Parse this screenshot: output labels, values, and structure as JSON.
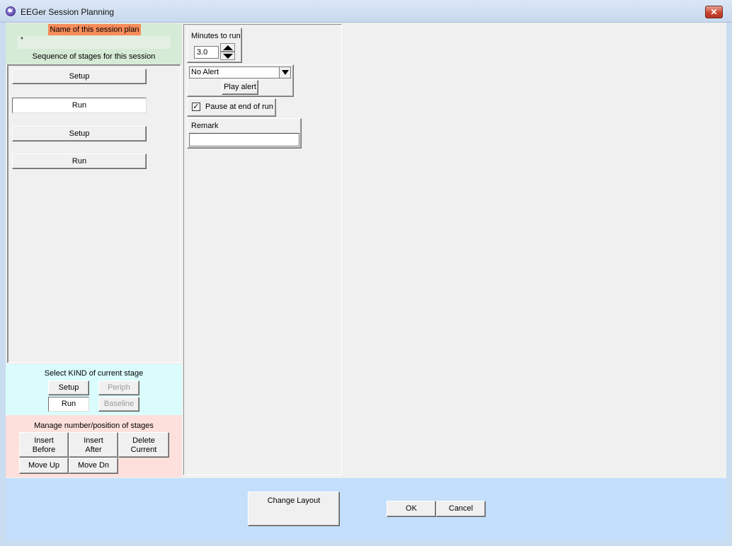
{
  "window": {
    "title": "EEGer Session Planning",
    "close_symbol": "✕",
    "icon_text": "W"
  },
  "name_panel": {
    "label": "Name of this session plan",
    "name_value": "*",
    "sequence_label": "Sequence of stages for this session"
  },
  "stages": [
    "Setup",
    "Run",
    "Setup",
    "Run"
  ],
  "selected_stage_index": 1,
  "kind_panel": {
    "title": "Select KIND of current stage",
    "setup": "Setup",
    "periph": "Periph",
    "run": "Run",
    "baseline": "Baseline"
  },
  "manage_panel": {
    "title": "Manage number/position of stages",
    "insert_before_1": "Insert",
    "insert_before_2": "Before",
    "insert_after_1": "Insert",
    "insert_after_2": "After",
    "delete_current_1": "Delete",
    "delete_current_2": "Current",
    "move_up": "Move Up",
    "move_dn": "Move Dn"
  },
  "run_settings": {
    "minutes_label": "Minutes to run",
    "minutes_value": "3.0",
    "alert_selected": "No Alert",
    "play_alert": "Play alert",
    "pause_label": "Pause at end of run",
    "pause_checked": "✓",
    "remark_label": "Remark",
    "remark_value": ""
  },
  "bottom": {
    "change_layout": "Change Layout",
    "ok": "OK",
    "cancel": "Cancel"
  }
}
